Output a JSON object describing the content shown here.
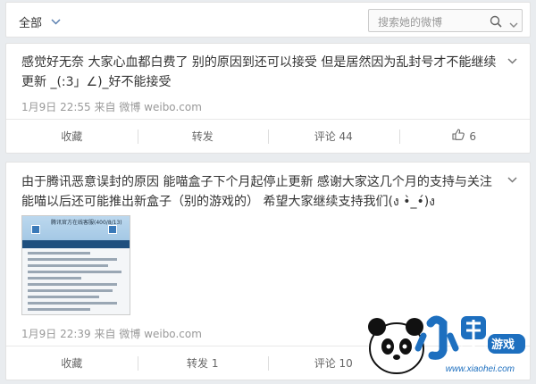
{
  "filter": {
    "label": "全部"
  },
  "search": {
    "placeholder": "搜索她的微博"
  },
  "posts": [
    {
      "text": "感觉好无奈 大家心血都白费了 别的原因到还可以接受 但是居然因为乱封号才不能继续更新 _(:3」∠)_好不能接受",
      "time": "1月9日 22:55",
      "source_prefix": "来自",
      "source": "微博 weibo.com",
      "actions": {
        "favorite": "收藏",
        "repost": "转发",
        "comment": "评论 44",
        "like": "6"
      }
    },
    {
      "text": "由于腾讯恶意误封的原因 能喵盒子下个月起停止更新 感谢大家这几个月的支持与关注 能喵以后还可能推出新盒子（别的游戏的） 希望大家继续支持我们(ง •̀_•́)ง",
      "time": "1月9日 22:39",
      "source_prefix": "来自",
      "source": "微博 weibo.com",
      "actions": {
        "favorite": "收藏",
        "repost": "转发 1",
        "comment": "评论 10",
        "like": ""
      },
      "thumbnail": {
        "title": "腾讯官方在线客服(400/8/13)"
      }
    }
  ],
  "watermark": {
    "brand": "小黑游戏",
    "url": "www.xiaohei.com"
  },
  "colors": {
    "background": "#e9ecef",
    "card": "#ffffff",
    "meta": "#999999",
    "text": "#333333"
  }
}
